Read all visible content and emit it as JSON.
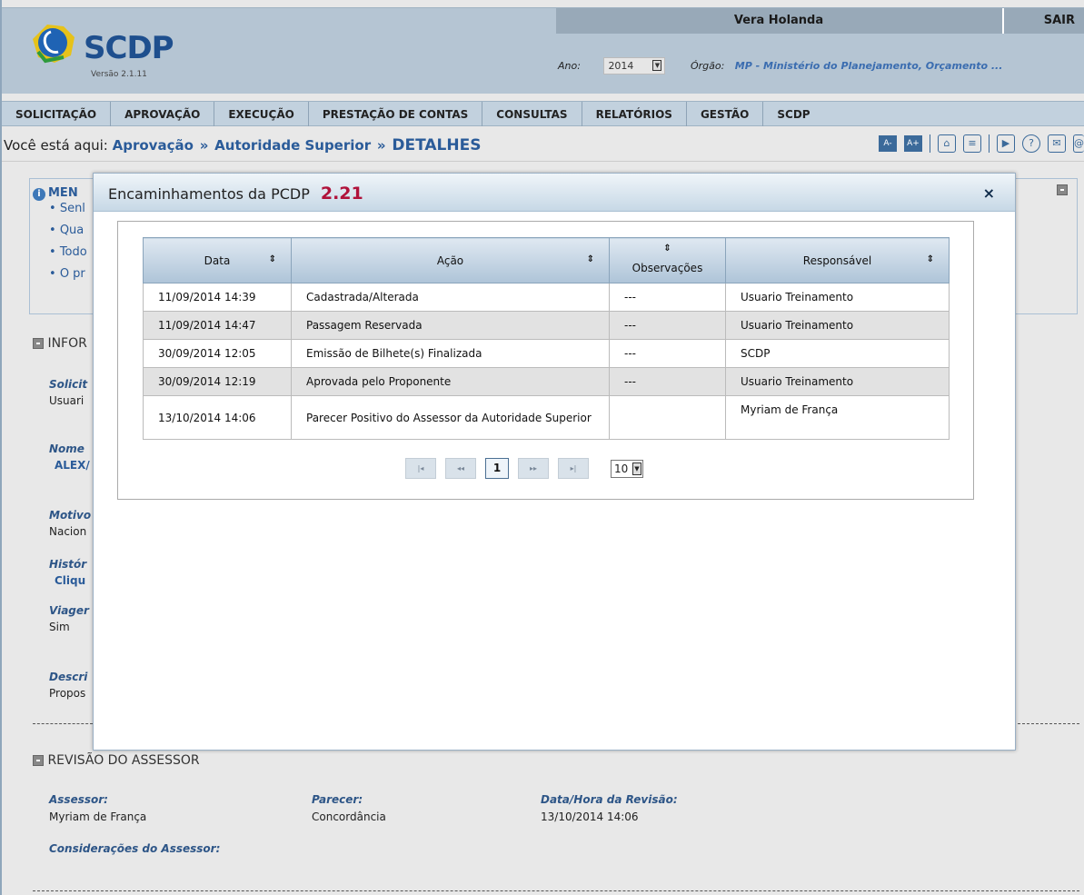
{
  "header": {
    "logo_name": "SCDP",
    "version": "Versão 2.1.11",
    "user_name": "Vera Holanda",
    "logout_label": "SAIR",
    "year_label": "Ano:",
    "year_value": "2014",
    "org_label": "Órgão:",
    "org_value": "MP - Ministério do Planejamento, Orçamento ..."
  },
  "menu": [
    "SOLICITAÇÃO",
    "APROVAÇÃO",
    "EXECUÇÃO",
    "PRESTAÇÃO DE CONTAS",
    "CONSULTAS",
    "RELATÓRIOS",
    "GESTÃO",
    "SCDP"
  ],
  "breadcrumb": {
    "prefix": "Você está aqui:",
    "items": [
      "Aprovação",
      "Autoridade Superior",
      "DETALHES"
    ],
    "separator": "»",
    "font_decrease": "A-",
    "font_increase": "A+"
  },
  "background": {
    "messages_title": "MEN",
    "message_items": [
      "Senl",
      "Qua",
      "Todo",
      "O pr"
    ],
    "info_title": "INFOR",
    "fields": [
      {
        "label": "Solicit",
        "value": "Usuari"
      },
      {
        "label": "Nome",
        "value": "ALEX/"
      },
      {
        "label": "Motivo",
        "value": "Nacion"
      },
      {
        "label": "Histór",
        "value": "Cliqu"
      },
      {
        "label": "Viager",
        "value": "Sim"
      },
      {
        "label": "Descri",
        "value": "Propos"
      }
    ],
    "review_title": "REVISÃO DO ASSESSOR",
    "review": {
      "assessor_label": "Assessor:",
      "assessor_value": "Myriam de França",
      "parecer_label": "Parecer:",
      "parecer_value": "Concordância",
      "datahora_label": "Data/Hora da Revisão:",
      "datahora_value": "13/10/2014 14:06",
      "consideracoes_label": "Considerações do Assessor:"
    }
  },
  "modal": {
    "title": "Encaminhamentos da PCDP",
    "code": "2.21",
    "close": "×",
    "columns": [
      "Data",
      "Ação",
      "Observações",
      "Responsável"
    ],
    "rows": [
      {
        "data": "11/09/2014 14:39",
        "acao": "Cadastrada/Alterada",
        "obs": "---",
        "resp": "Usuario Treinamento"
      },
      {
        "data": "11/09/2014 14:47",
        "acao": "Passagem Reservada",
        "obs": "---",
        "resp": "Usuario Treinamento"
      },
      {
        "data": "30/09/2014 12:05",
        "acao": "Emissão de Bilhete(s) Finalizada",
        "obs": "---",
        "resp": "SCDP"
      },
      {
        "data": "30/09/2014 12:19",
        "acao": "Aprovada pelo Proponente",
        "obs": "---",
        "resp": "Usuario Treinamento"
      },
      {
        "data": "13/10/2014 14:06",
        "acao": "Parecer Positivo do Assessor da Autoridade Superior",
        "obs": "",
        "resp": "Myriam de França"
      }
    ],
    "pager": {
      "first": "|◂",
      "prev": "◂◂",
      "current": "1",
      "next": "▸▸",
      "last": "▸|",
      "page_size": "10"
    }
  }
}
